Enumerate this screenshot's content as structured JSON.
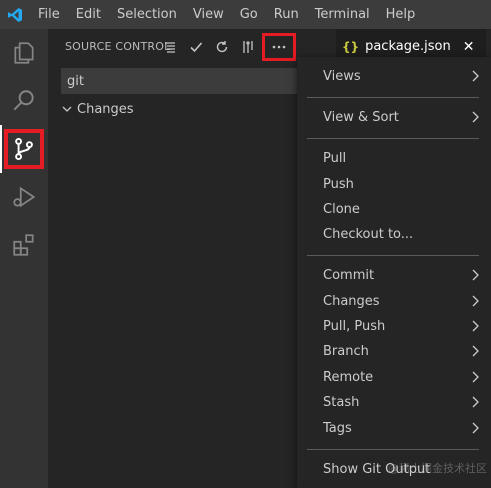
{
  "menubar": {
    "items": [
      "File",
      "Edit",
      "Selection",
      "View",
      "Go",
      "Run",
      "Terminal",
      "Help"
    ]
  },
  "activitybar": {
    "icons": [
      "explorer-icon",
      "search-icon",
      "source-control-icon",
      "run-debug-icon",
      "extensions-icon"
    ]
  },
  "sidebar": {
    "title": "SOURCE CONTROL",
    "commit_input_value": "git",
    "changes_label": "Changes"
  },
  "editor": {
    "tab_label": "package.json",
    "tab_icon": "{}"
  },
  "context_menu": {
    "items": [
      {
        "label": "Views",
        "submenu": true
      },
      {
        "label": "View & Sort",
        "submenu": true
      },
      {
        "label": "Pull",
        "submenu": false
      },
      {
        "label": "Push",
        "submenu": false
      },
      {
        "label": "Clone",
        "submenu": false
      },
      {
        "label": "Checkout to...",
        "submenu": false
      },
      {
        "label": "Commit",
        "submenu": true
      },
      {
        "label": "Changes",
        "submenu": true
      },
      {
        "label": "Pull, Push",
        "submenu": true
      },
      {
        "label": "Branch",
        "submenu": true
      },
      {
        "label": "Remote",
        "submenu": true
      },
      {
        "label": "Stash",
        "submenu": true
      },
      {
        "label": "Tags",
        "submenu": true
      },
      {
        "label": "Show Git Output",
        "submenu": false
      }
    ]
  },
  "watermark": "@稀土掘金技术社区",
  "colors": {
    "highlight": "#e51c23",
    "background": "#1e1e1e",
    "sidebar": "#252526",
    "activitybar": "#333333"
  }
}
